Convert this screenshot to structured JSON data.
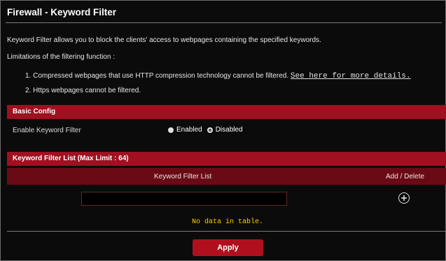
{
  "page": {
    "title": "Firewall - Keyword Filter",
    "description": "Keyword Filter allows you to block the clients' access to webpages containing the specified keywords.",
    "limitations_heading": "Limitations of the filtering function :",
    "limitations": [
      {
        "text": "1. Compressed webpages that use HTTP compression technology cannot be filtered.",
        "link": "See here for more details."
      },
      {
        "text": "2. Https webpages cannot be filtered."
      }
    ]
  },
  "basic_config": {
    "header": "Basic Config",
    "enable_label": "Enable Keyword Filter",
    "options": [
      "Enabled",
      "Disabled"
    ],
    "selected": "Disabled"
  },
  "keyword_list": {
    "header": "Keyword Filter List (Max Limit : 64)",
    "columns": [
      "Keyword Filter List",
      "Add / Delete"
    ],
    "input_value": "",
    "empty_message": "No data in table."
  },
  "actions": {
    "apply_label": "Apply"
  },
  "colors": {
    "accent": "#a01020",
    "message": "#ffcc00"
  },
  "icons": {
    "add": "plus-circle-icon"
  }
}
